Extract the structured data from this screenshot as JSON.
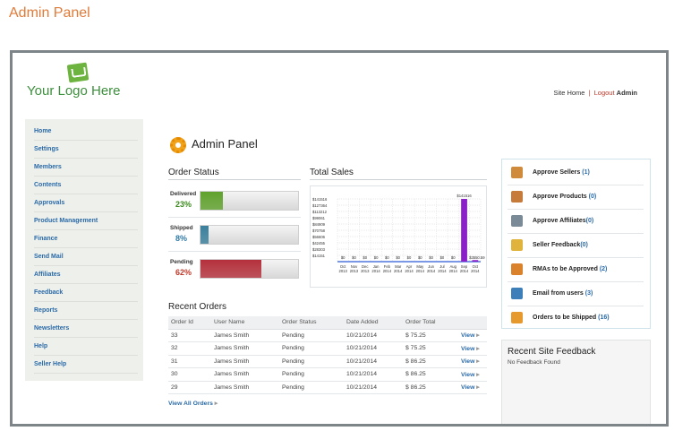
{
  "page_title": "Admin Panel",
  "logo_text": "Your Logo Here",
  "top_links": {
    "site_home": "Site Home",
    "separator": "|",
    "logout": "Logout",
    "user": "Admin"
  },
  "sidebar": {
    "items": [
      {
        "label": "Home"
      },
      {
        "label": "Settings"
      },
      {
        "label": "Members"
      },
      {
        "label": "Contents"
      },
      {
        "label": "Approvals"
      },
      {
        "label": "Product Management"
      },
      {
        "label": "Finance"
      },
      {
        "label": "Send Mail"
      },
      {
        "label": "Affiliates"
      },
      {
        "label": "Feedback"
      },
      {
        "label": "Reports"
      },
      {
        "label": "Newsletters"
      },
      {
        "label": "Help"
      },
      {
        "label": "Seller Help"
      }
    ]
  },
  "main": {
    "title": "Admin Panel"
  },
  "order_status": {
    "title": "Order Status",
    "rows": [
      {
        "label": "Delivered",
        "pct_text": "23%",
        "fraction": 0.23,
        "color": "#5fa12c",
        "text_color": "#3d8a1f"
      },
      {
        "label": "Shipped",
        "pct_text": "8%",
        "fraction": 0.08,
        "color": "#3a7f9c",
        "text_color": "#2f7aa6"
      },
      {
        "label": "Pending",
        "pct_text": "62%",
        "fraction": 0.62,
        "color": "#b4303b",
        "text_color": "#c0392b"
      }
    ]
  },
  "total_sales": {
    "title": "Total Sales"
  },
  "chart_data": {
    "type": "bar",
    "title": "Total Sales",
    "categories": [
      "Oct 2013",
      "Nov 2013",
      "Dec 2013",
      "Jan 2014",
      "Feb 2014",
      "Mar 2014",
      "Apr 2014",
      "May 2014",
      "Jun 2014",
      "Jul 2014",
      "Aug 2014",
      "Sep 2014",
      "Oct 2014"
    ],
    "values": [
      0,
      0,
      0,
      0,
      0,
      0,
      0,
      0,
      0,
      0,
      0,
      141516,
      3550.59
    ],
    "bar_value_labels": [
      "$0",
      "$0",
      "$0",
      "$0",
      "$0",
      "$0",
      "$0",
      "$0",
      "$0",
      "$0",
      "$0",
      "$141516",
      "$3550.59"
    ],
    "y_tick_labels": [
      "$14151",
      "$28303",
      "$42455",
      "$56606",
      "$70758",
      "$84909",
      "$99061",
      "$113212",
      "$127364",
      "$141516"
    ],
    "y_ticks": [
      14151,
      28303,
      42455,
      56606,
      70758,
      84909,
      99061,
      113212,
      127364,
      141516
    ],
    "ylim": [
      0,
      141516
    ],
    "grid": true,
    "bar_color": "#8b20c9",
    "baseline_color": "#2a5bd7"
  },
  "recent_orders": {
    "title": "Recent Orders",
    "columns": [
      "Order Id",
      "User Name",
      "Order Status",
      "Date Added",
      "Order Total",
      ""
    ],
    "rows": [
      {
        "id": "33",
        "user": "James Smith",
        "status": "Pending",
        "date": "10/21/2014",
        "total": "$  75.25",
        "action": "View"
      },
      {
        "id": "32",
        "user": "James Smith",
        "status": "Pending",
        "date": "10/21/2014",
        "total": "$  75.25",
        "action": "View"
      },
      {
        "id": "31",
        "user": "James Smith",
        "status": "Pending",
        "date": "10/21/2014",
        "total": "$  86.25",
        "action": "View"
      },
      {
        "id": "30",
        "user": "James Smith",
        "status": "Pending",
        "date": "10/21/2014",
        "total": "$  86.25",
        "action": "View"
      },
      {
        "id": "29",
        "user": "James Smith",
        "status": "Pending",
        "date": "10/21/2014",
        "total": "$  86.25",
        "action": "View"
      }
    ],
    "view_all": "View All Orders"
  },
  "quick_actions": {
    "items": [
      {
        "label": "Approve Sellers",
        "count": "(1)",
        "icon": "user-icon",
        "color": "#d08a3c"
      },
      {
        "label": "Approve Products",
        "count": "(0)",
        "icon": "box-icon",
        "color": "#c77b3a"
      },
      {
        "label": "Approve Affiliates",
        "count": "(0)",
        "icon": "group-icon",
        "color": "#7a8a96"
      },
      {
        "label": "Seller Feedback",
        "count": "(0)",
        "icon": "pencil-icon",
        "color": "#e0b33c"
      },
      {
        "label": "RMAs to be Approved",
        "count": "(2)",
        "icon": "dollar-icon",
        "color": "#d9822b"
      },
      {
        "label": "Email from users",
        "count": "(3)",
        "icon": "mail-icon",
        "color": "#3d7fb8"
      },
      {
        "label": "Orders to be Shipped",
        "count": "(16)",
        "icon": "clipboard-icon",
        "color": "#e69a2e"
      }
    ]
  },
  "site_feedback": {
    "title": "Recent Site Feedback",
    "text": "No Feedback Found"
  }
}
